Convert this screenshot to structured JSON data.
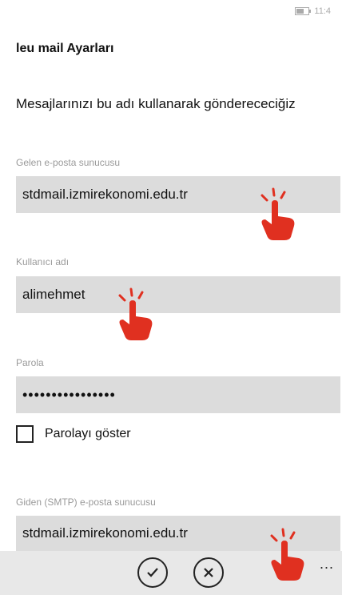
{
  "status_bar": {
    "time": "11:4"
  },
  "page_title": "leu mail Ayarları",
  "description": "Mesajlarınızı bu adı kullanarak gönderececiğiz",
  "fields": [
    {
      "label": "Gelen e-posta sunucusu",
      "value": "stdmail.izmirekonomi.edu.tr"
    },
    {
      "label": "Kullanıcı adı",
      "value": "alimehmet"
    },
    {
      "label": "Parola",
      "value": "••••••••••••••••"
    },
    {
      "label": "Giden (SMTP) e-posta sunucusu",
      "value": "stdmail.izmirekonomi.edu.tr"
    }
  ],
  "show_password": {
    "label": "Parolayı göster",
    "checked": false
  },
  "app_bar": {
    "more": "..."
  },
  "colors": {
    "field_bg": "#dcdcdc",
    "label_gray": "#9a9a9a",
    "hand_red": "#e03020",
    "app_bar_bg": "#e8e8e8"
  },
  "icons": [
    "battery-icon",
    "check-circle-icon",
    "close-circle-icon",
    "more-icon",
    "tap-hand-icon"
  ]
}
